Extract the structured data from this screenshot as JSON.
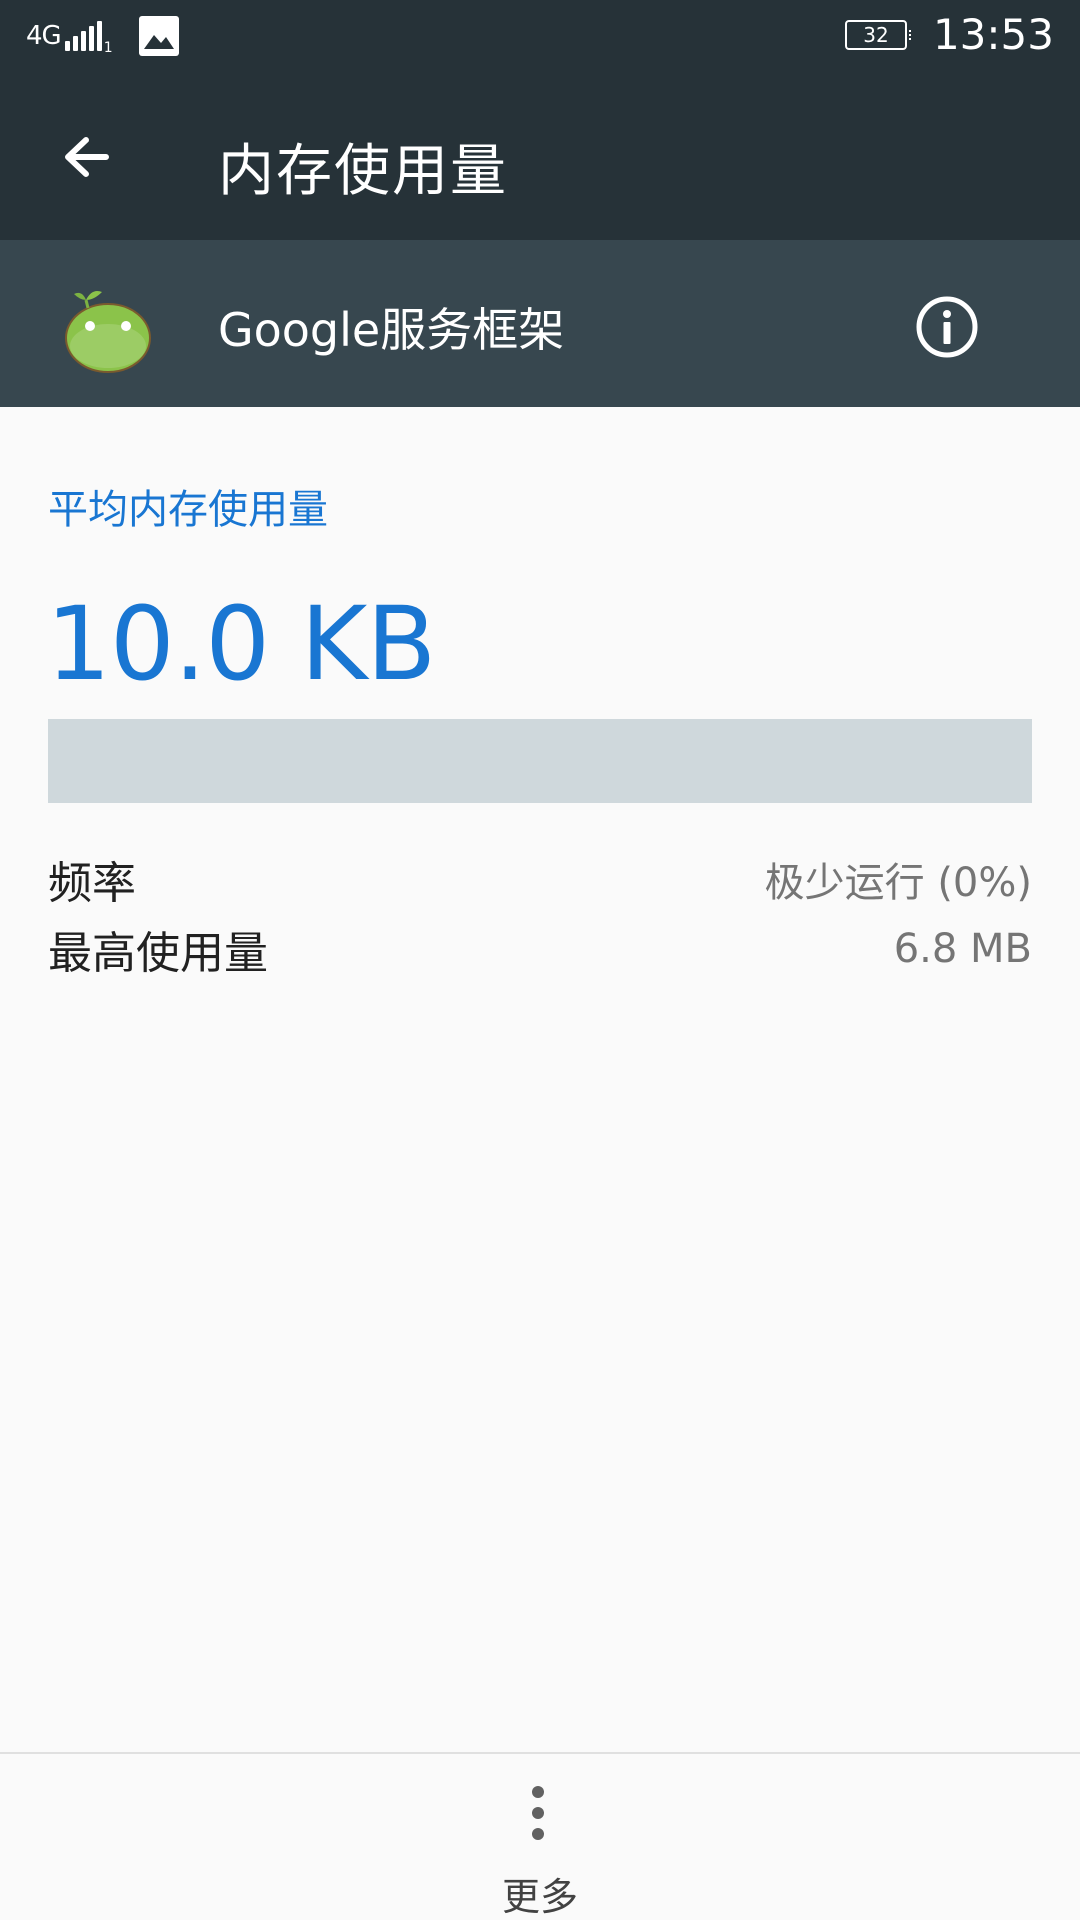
{
  "status_bar": {
    "network": "4G",
    "sim_slot": "1",
    "battery": "32",
    "time": "13:53"
  },
  "toolbar": {
    "title": "内存使用量",
    "back_icon": "arrow-back-icon"
  },
  "app": {
    "name": "Google服务框架",
    "icon": "android-app-icon",
    "info_icon": "info-icon"
  },
  "memory": {
    "section_label": "平均内存使用量",
    "average_value": "10.0 KB",
    "usage_fraction": 0.0,
    "frequency_label": "频率",
    "frequency_value": "极少运行 (0%)",
    "max_label": "最高使用量",
    "max_value": "6.8 MB"
  },
  "bottom": {
    "more_label": "更多",
    "more_icon": "more-vert-icon"
  },
  "colors": {
    "toolbar_bg": "#263238",
    "header_bg": "#37474f",
    "accent": "#1976d2",
    "bar_track": "#cfd8dc"
  }
}
